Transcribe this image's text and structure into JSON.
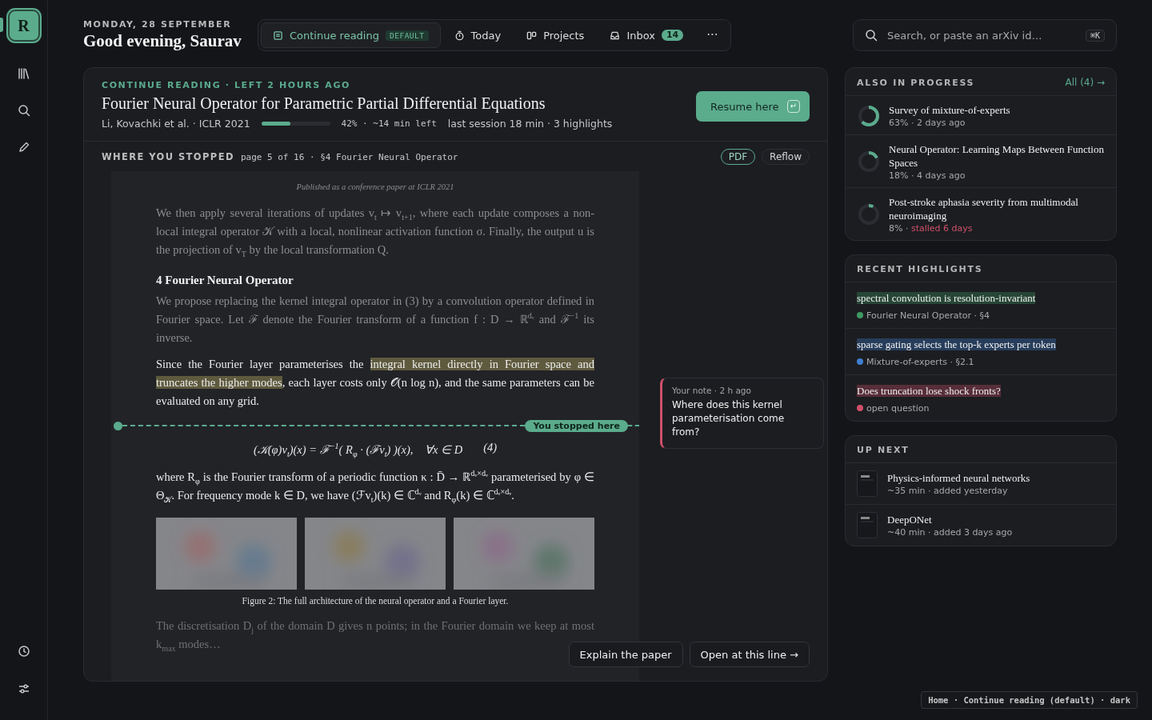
{
  "sidebar": {
    "logo": "R",
    "logo_selected": true
  },
  "header": {
    "date": "MONDAY, 28 SEPTEMBER",
    "greeting": "Good evening, Saurav"
  },
  "tabs": [
    {
      "label": "Continue reading",
      "selected": true,
      "badge": "DEFAULT"
    },
    {
      "label": "Today",
      "selected": false
    },
    {
      "label": "Projects",
      "selected": false
    },
    {
      "label": "Inbox",
      "selected": false,
      "count": "14"
    }
  ],
  "more": "···",
  "search": {
    "placeholder": "Search, or paste an arXiv id…",
    "shortcut": "⌘K"
  },
  "current": {
    "eyebrow": "CONTINUE READING · LEFT 2 HOURS AGO",
    "title": "Fourier Neural Operator for Parametric Partial Differential Equations",
    "authors": "Li, Kovachki et al. · ICLR 2021",
    "level": 0.42,
    "progress_text": "42% · ~14 min left",
    "session": "last session 18 min · 3 highlights",
    "resume": "Resume here",
    "resume_key": "↵"
  },
  "stopped": {
    "label": "WHERE YOU STOPPED",
    "location": "page 5 of 16 · §4 Fourier Neural Operator",
    "views": [
      {
        "label": "PDF",
        "selected": true
      },
      {
        "label": "Reflow",
        "selected": false
      }
    ]
  },
  "paper": {
    "running_head": "Published as a conference paper at ICLR 2021",
    "blocks": [
      {
        "kind": "dimtext",
        "segments": [
          {
            "text": "We then apply several iterations of updates v$_{t}$ ↦ v$_{t+1}$, where each update composes a non-local integral operator 𝒦 with a local, nonlinear activation function σ. Finally, the output u is the projection of v$_{T}$ by the local transformation Q.",
            "highlighted": false
          }
        ]
      },
      {
        "kind": "heading",
        "number": "4",
        "text": "Fourier Neural Operator"
      },
      {
        "kind": "dimtext",
        "segments": [
          {
            "text": "We propose replacing the kernel integral operator in (3) by a convolution operator defined in Fourier space. Let ℱ denote the Fourier transform of a function f : D → ℝ$^{dᵥ}$ and ℱ$^{−1}$ its inverse.",
            "highlighted": false
          }
        ]
      },
      {
        "kind": "text",
        "segments": [
          {
            "text": "Since the Fourier layer parameterises the ",
            "highlighted": false
          },
          {
            "text": "integral kernel directly in Fourier space and truncates the higher modes",
            "highlighted": true
          },
          {
            "text": ", each layer costs only 𝒪(n log n), and the same parameters can be evaluated on any grid.",
            "highlighted": false
          }
        ]
      },
      {
        "kind": "stop",
        "label": "You stopped here"
      },
      {
        "kind": "equation",
        "text": "(𝒦(φ)v$_{t}$)(x) = ℱ$^{−1}$( R$_{φ}$ · (ℱv$_{t}$) )(x),    ∀x ∈ D",
        "number": "(4)"
      },
      {
        "kind": "text",
        "segments": [
          {
            "text": "where R$_{φ}$ is the Fourier transform of a periodic function κ : D̄ → ℝ$^{dᵥ×dᵥ}$ parameterised by φ ∈ Θ$_{𝒦}$. For frequency mode k ∈ D, we have (ℱv$_{t}$)(k) ∈ ℂ$^{dᵥ}$ and R$_{φ}$(k) ∈ ℂ$^{dᵥ×dᵥ}$.",
            "highlighted": false
          }
        ]
      },
      {
        "kind": "figure",
        "caption": "Figure 2: The full architecture of the neural operator and a Fourier layer."
      },
      {
        "kind": "fadetext",
        "segments": [
          {
            "text": "The discretisation D$_{j}$ of the domain D gives n points; in the Fourier domain we keep at most k$_{max}$ modes…",
            "highlighted": false
          }
        ]
      }
    ]
  },
  "note": {
    "meta": "Your note · 2 h ago",
    "text": "Where does this kernel parameterisation come from?"
  },
  "actions": [
    "Explain the paper",
    "Open at this line →"
  ],
  "in_progress": {
    "title": "ALSO IN PROGRESS",
    "link": "All (4) →",
    "separator": "·",
    "items": [
      {
        "title": "Survey of mixture-of-experts",
        "level": 0.63,
        "percent": "63%",
        "when": "2 days ago",
        "stalled": false
      },
      {
        "title": "Neural Operator: Learning Maps Between Function Spaces",
        "level": 0.18,
        "percent": "18%",
        "when": "4 days ago",
        "stalled": false
      },
      {
        "title": "Post-stroke aphasia severity from multimodal neuroimaging",
        "level": 0.08,
        "percent": "8%",
        "when": "stalled 6 days",
        "stalled": true
      }
    ]
  },
  "highlights": {
    "title": "RECENT HIGHLIGHTS",
    "items": [
      {
        "text": "spectral convolution is resolution-invariant",
        "source": "Fourier Neural Operator · §4",
        "color": "#3f9a62"
      },
      {
        "text": "sparse gating selects the top-k experts per token",
        "source": "Mixture-of-experts · §2.1",
        "color": "#3f7fd0"
      },
      {
        "text": "Does truncation lose shock fronts?",
        "source": "open question",
        "color": "#d0506a"
      }
    ]
  },
  "up_next": {
    "title": "UP NEXT",
    "items": [
      {
        "title": "Physics-informed neural networks",
        "meta": "~35 min · added yesterday"
      },
      {
        "title": "DeepONet",
        "meta": "~40 min · added 3 days ago"
      }
    ]
  },
  "footer": "Home · Continue reading (default) · dark"
}
